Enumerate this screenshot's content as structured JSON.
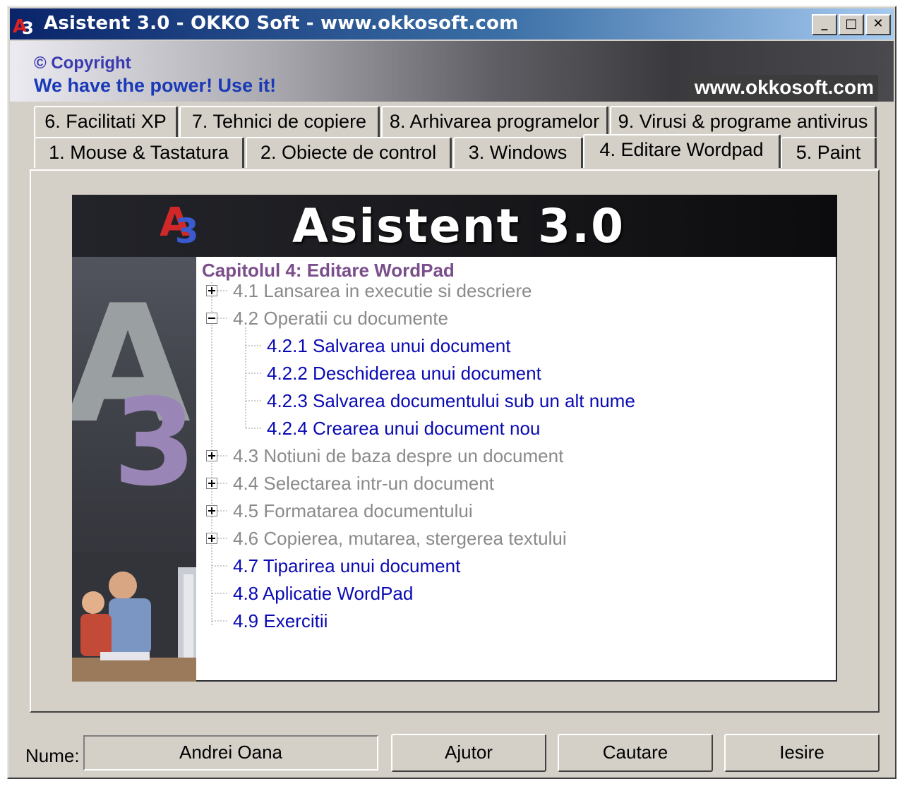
{
  "window": {
    "title": "Asistent 3.0 - OKKO Soft - www.okkosoft.com",
    "controls": {
      "minimize": "_",
      "maximize": "□",
      "close": "✕"
    }
  },
  "banner": {
    "copyright": "© Copyright",
    "slogan": "We have the power! Use it!",
    "url": "www.okkosoft.com"
  },
  "tabs": {
    "row_back": [
      {
        "label": "6. Facilitati XP"
      },
      {
        "label": "7. Tehnici de copiere"
      },
      {
        "label": "8. Arhivarea programelor"
      },
      {
        "label": "9. Virusi & programe antivirus"
      }
    ],
    "row_front": [
      {
        "label": "1. Mouse & Tastatura"
      },
      {
        "label": "2. Obiecte de control"
      },
      {
        "label": "3. Windows"
      },
      {
        "label": "4. Editare Wordpad",
        "active": true
      },
      {
        "label": "5. Paint"
      }
    ]
  },
  "content": {
    "header_title": "Asistent 3.0",
    "logo_text": "A3",
    "chapter_title": "Capitolul 4: Editare WordPad",
    "tree": [
      {
        "label": "4.1 Lansarea in executie si descriere",
        "expander": "plus"
      },
      {
        "label": "4.2 Operatii cu documente",
        "expander": "minus"
      },
      {
        "label": "4.2.1 Salvarea unui document"
      },
      {
        "label": "4.2.2 Deschiderea unui document"
      },
      {
        "label": "4.2.3 Salvarea documentului sub un alt nume"
      },
      {
        "label": "4.2.4 Crearea unui document nou"
      },
      {
        "label": "4.3 Notiuni de baza despre un document",
        "expander": "plus"
      },
      {
        "label": "4.4 Selectarea intr-un document",
        "expander": "plus"
      },
      {
        "label": "4.5 Formatarea documentului",
        "expander": "plus"
      },
      {
        "label": "4.6 Copierea, mutarea, stergerea textului",
        "expander": "plus"
      },
      {
        "label": "4.7 Tiparirea unui document"
      },
      {
        "label": "4.8 Aplicatie WordPad"
      },
      {
        "label": "4.9 Exercitii"
      }
    ]
  },
  "footer": {
    "name_label": "Nume:",
    "name_value": "Andrei Oana",
    "buttons": {
      "help": "Ajutor",
      "search": "Cautare",
      "exit": "Iesire"
    }
  }
}
